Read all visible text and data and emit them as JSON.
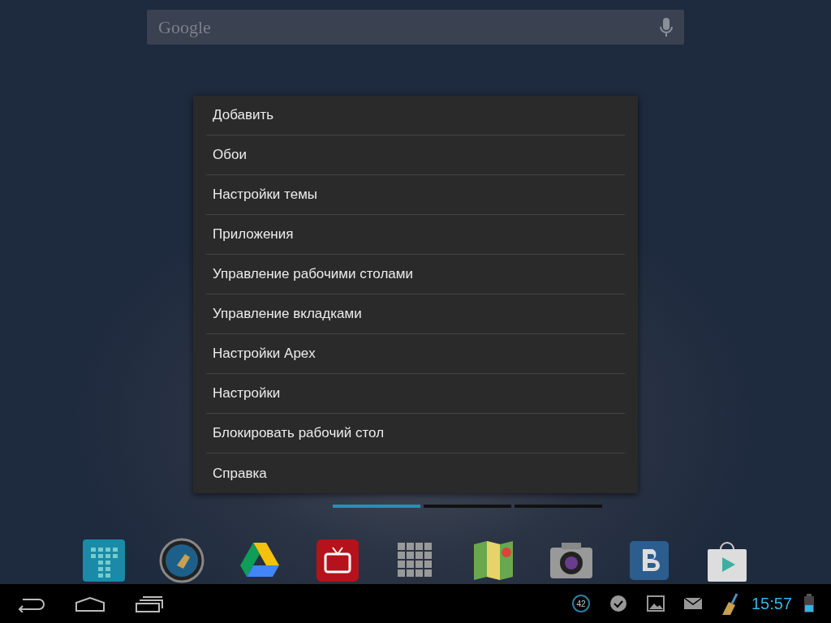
{
  "search": {
    "placeholder": "Google"
  },
  "menu": {
    "items": [
      {
        "label": "Добавить"
      },
      {
        "label": "Обои"
      },
      {
        "label": "Настройки темы"
      },
      {
        "label": "Приложения"
      },
      {
        "label": "Управление рабочими столами"
      },
      {
        "label": "Управление вкладками"
      },
      {
        "label": "Настройки Apex"
      },
      {
        "label": "Настройки"
      },
      {
        "label": "Блокировать рабочий стол"
      },
      {
        "label": "Справка"
      }
    ]
  },
  "page_indicator": [
    {
      "selected": true
    },
    {
      "selected": false
    },
    {
      "selected": false
    }
  ],
  "dock": [
    {
      "kind": "grid-tile"
    },
    {
      "kind": "broom-circle"
    },
    {
      "kind": "triangle"
    },
    {
      "kind": "tv"
    },
    {
      "kind": "app-grid"
    },
    {
      "kind": "map"
    },
    {
      "kind": "camera"
    },
    {
      "kind": "letter-tile"
    },
    {
      "kind": "bag"
    }
  ],
  "status_bar": {
    "notification_count": "42",
    "time": "15:57",
    "battery": {
      "level": 0.45
    }
  }
}
